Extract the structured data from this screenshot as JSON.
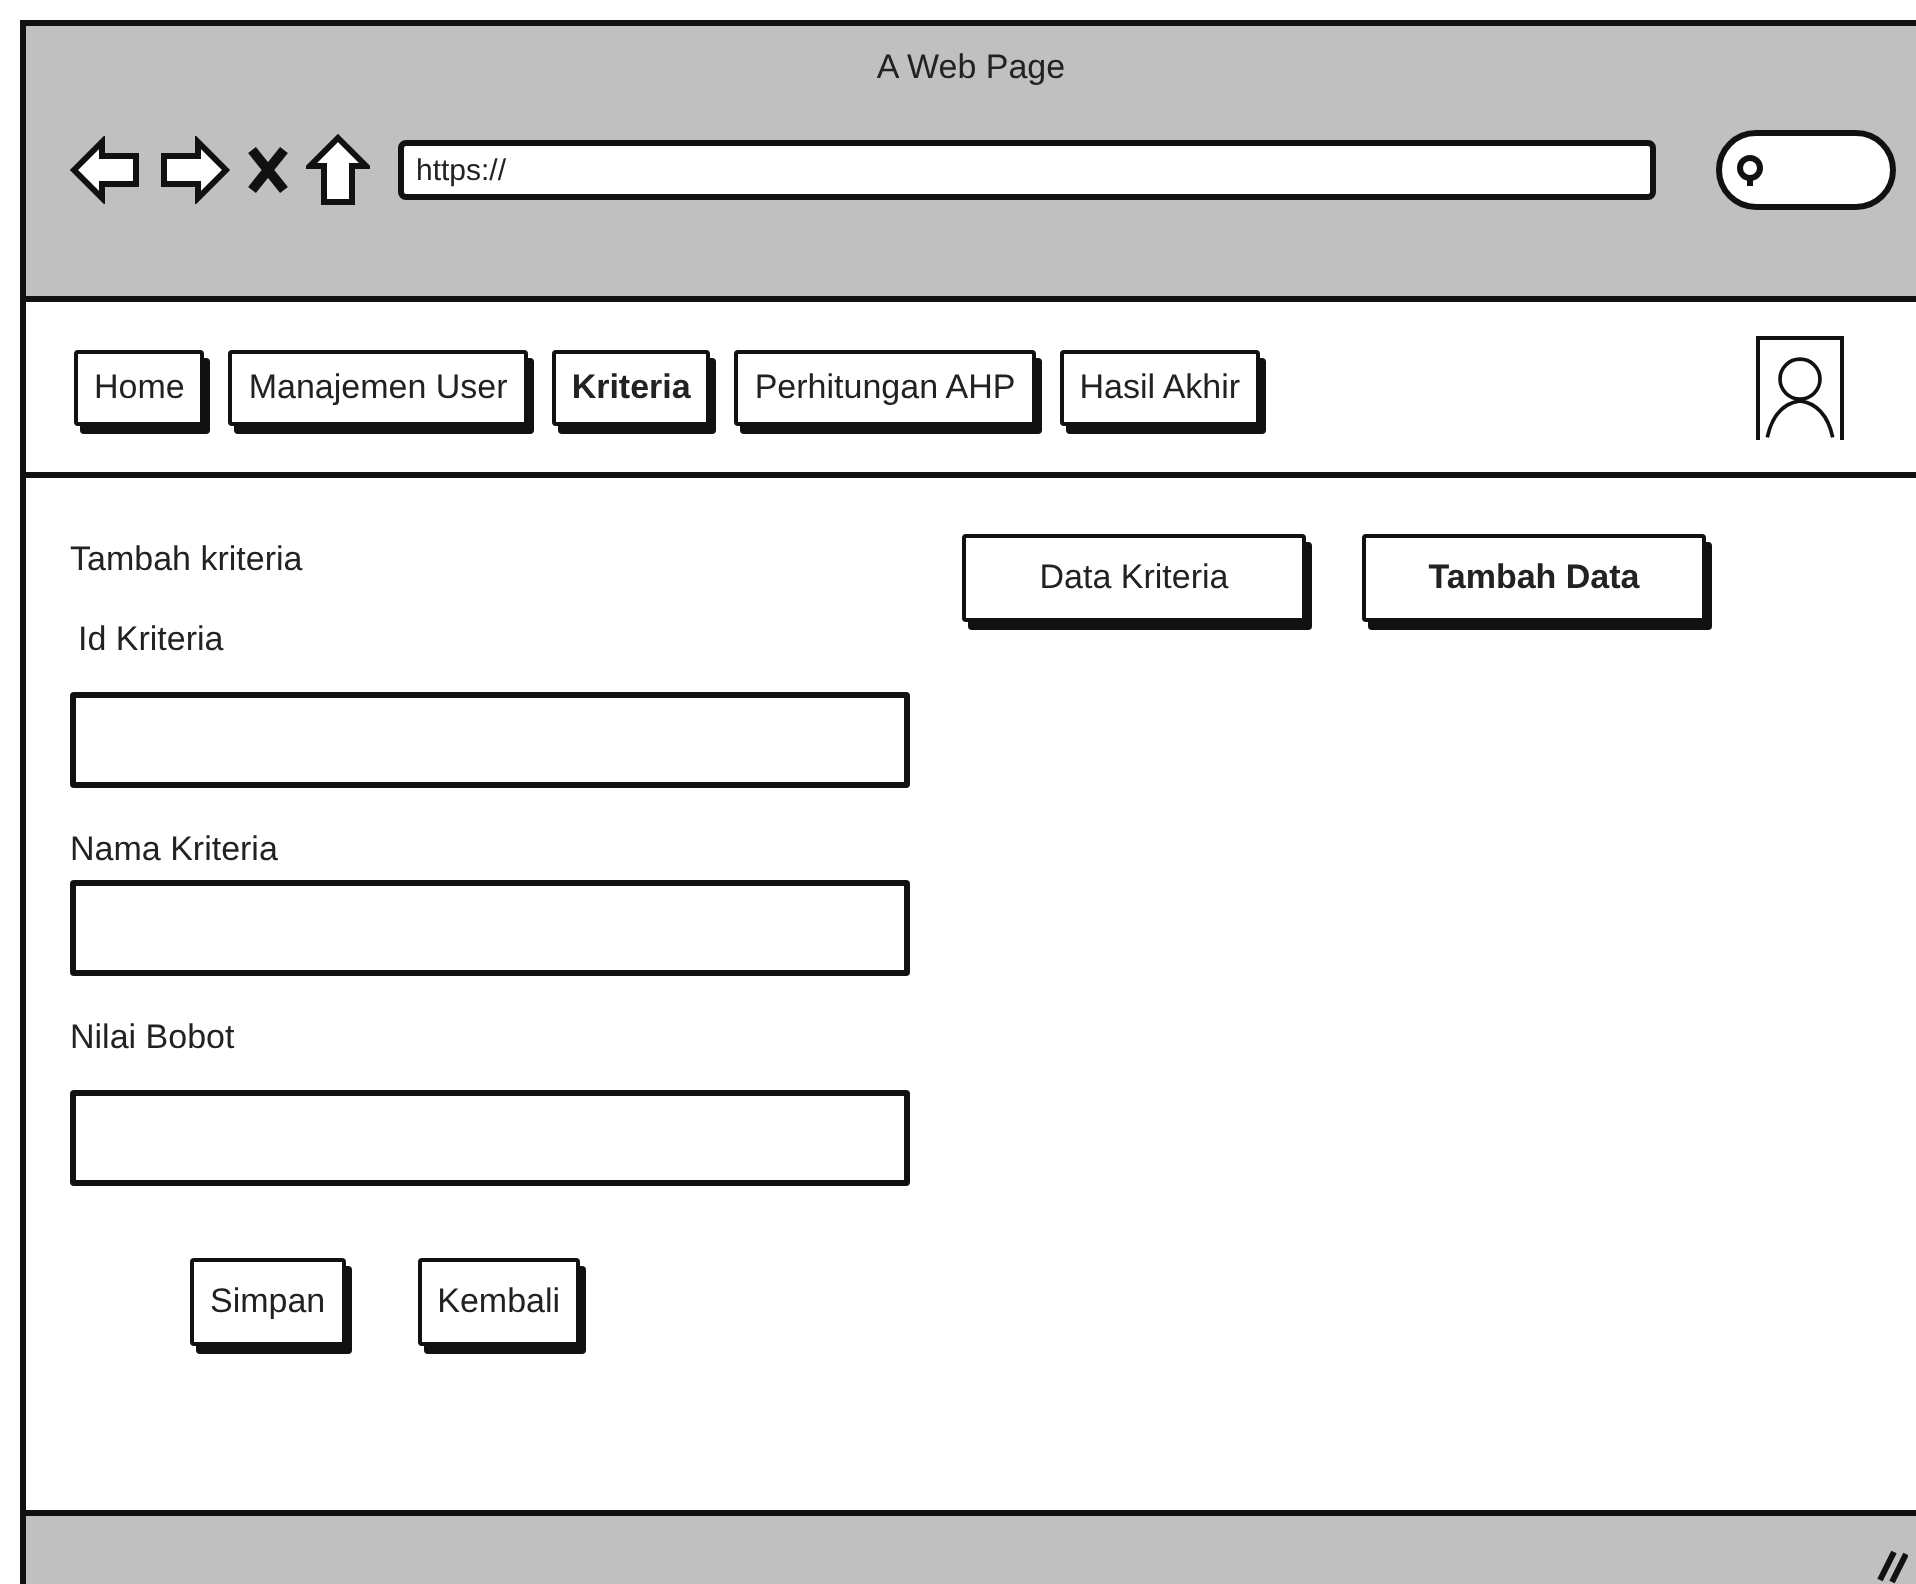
{
  "window": {
    "title": "A Web Page"
  },
  "address_bar": {
    "value": "https://"
  },
  "nav": [
    {
      "label": "Home",
      "selected": false
    },
    {
      "label": "Manajemen User",
      "selected": false
    },
    {
      "label": "Kriteria",
      "selected": true
    },
    {
      "label": "Perhitungan AHP",
      "selected": false
    },
    {
      "label": "Hasil Akhir",
      "selected": false
    }
  ],
  "form": {
    "heading": "Tambah kriteria",
    "fields": [
      {
        "label": "Id Kriteria"
      },
      {
        "label": "Nama Kriteria"
      },
      {
        "label": "Nilai Bobot"
      }
    ],
    "buttons": [
      "Simpan",
      "Kembali"
    ]
  },
  "actions": [
    {
      "label": "Data Kriteria",
      "selected": false
    },
    {
      "label": "Tambah Data",
      "selected": true
    }
  ]
}
